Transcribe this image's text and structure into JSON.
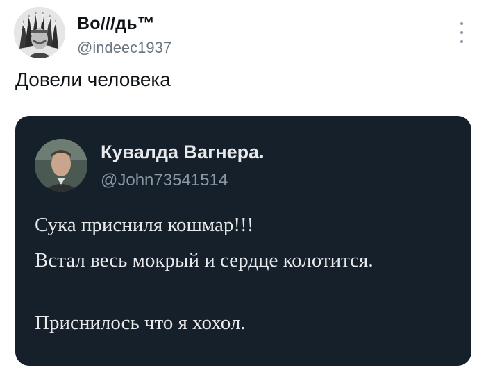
{
  "tweet": {
    "author_name": "Во///дь™",
    "author_handle": "@indeec1937",
    "text": "Довели человека",
    "more_icon": "more-vertical-icon"
  },
  "quoted_tweet": {
    "author_name": "Кувалда Вагнера.",
    "author_handle": "@John73541514",
    "lines": [
      "Сука присниля кошмар!!!",
      "Встал весь мокрый и сердце колотится.",
      "Приснилось что я хохол."
    ]
  },
  "colors": {
    "card_background": "#15202b",
    "card_text": "#e7e9ea",
    "card_secondary_text": "#8b98a5",
    "page_text": "#0f1419",
    "page_secondary_text": "#6b7580"
  }
}
